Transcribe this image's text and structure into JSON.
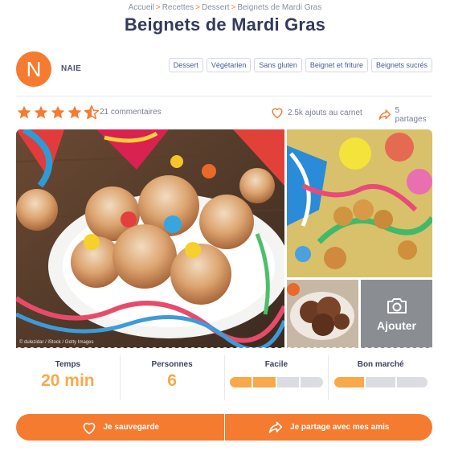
{
  "breadcrumb": {
    "items": [
      "Accueil",
      "Recettes",
      "Dessert",
      "Beignets de Mardi Gras"
    ],
    "separator": ">"
  },
  "recipe": {
    "title": "Beignets de Mardi Gras"
  },
  "author": {
    "initial": "N",
    "name": "NAIE"
  },
  "tags": [
    "Dessert",
    "Végétarien",
    "Sans gluten",
    "Beignet et friture",
    "Beignets sucrés"
  ],
  "rating": {
    "stars": 4.5,
    "max": 5,
    "comments_label": "21 commentaires",
    "saves_label": "2.5k ajouts au carnet",
    "shares_label": "5 partages"
  },
  "gallery": {
    "photo_credit": "© dulezidar / iStock / Getty Images",
    "add_photo_label": "Ajouter"
  },
  "info": {
    "time_label": "Temps",
    "time_value": "20 min",
    "people_label": "Personnes",
    "people_value": "6",
    "difficulty_label": "Facile",
    "difficulty_level": 2,
    "difficulty_max": 4,
    "cost_label": "Bon marché",
    "cost_level": 1,
    "cost_max": 3
  },
  "actions": {
    "save_label": "Je sauvegarde",
    "share_label": "Je partage avec mes amis"
  },
  "colors": {
    "accent": "#f47b30",
    "accent_light": "#f9a84b",
    "title": "#333a5c",
    "muted": "#8a8fa6"
  }
}
